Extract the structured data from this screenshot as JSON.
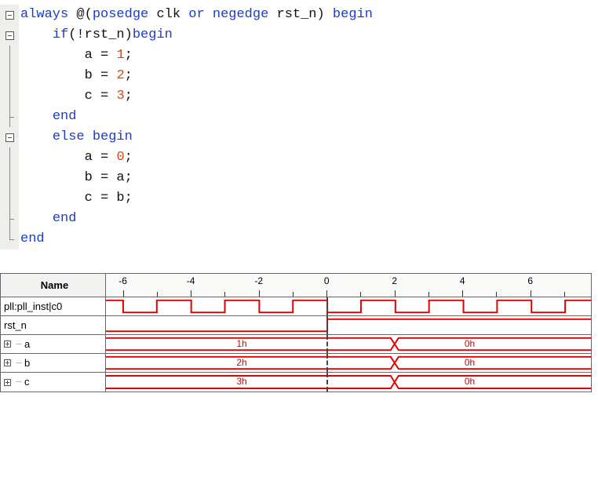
{
  "code": {
    "l1": {
      "kw1": "always",
      "at": " @(",
      "kw2": "posedge",
      "sp1": " clk ",
      "kw3": "or",
      "sp2": " ",
      "kw4": "negedge",
      "sp3": " rst_n) ",
      "kw5": "begin"
    },
    "l2": {
      "ind": "    ",
      "kw1": "if",
      "cond": "(!rst_n)",
      "kw2": "begin"
    },
    "l3": {
      "ind": "        ",
      "txt": "a = ",
      "num": "1",
      "semi": ";"
    },
    "l4": {
      "ind": "        ",
      "txt": "b = ",
      "num": "2",
      "semi": ";"
    },
    "l5": {
      "ind": "        ",
      "txt": "c = ",
      "num": "3",
      "semi": ";"
    },
    "l6": {
      "ind": "    ",
      "kw": "end"
    },
    "l7": {
      "ind": "    ",
      "kw1": "else",
      "sp": " ",
      "kw2": "begin"
    },
    "l8": {
      "ind": "        ",
      "txt": "a = ",
      "num": "0",
      "semi": ";"
    },
    "l9": {
      "ind": "        ",
      "txt": "b = a;"
    },
    "l10": {
      "ind": "        ",
      "txt": "c = b;"
    },
    "l11": {
      "ind": "    ",
      "kw": "end"
    },
    "l12": {
      "kw": "end"
    }
  },
  "wave": {
    "header": "Name",
    "ticks": [
      "-6",
      "-4",
      "-2",
      "0",
      "2",
      "4",
      "6"
    ],
    "signals": {
      "clk": "pll:pll_inst|c0",
      "rst": "rst_n",
      "a": "a",
      "b": "b",
      "c": "c"
    },
    "bus": {
      "a": {
        "before": "1h",
        "after": "0h"
      },
      "b": {
        "before": "2h",
        "after": "0h"
      },
      "c": {
        "before": "3h",
        "after": "0h"
      }
    }
  },
  "chart_data": {
    "type": "table",
    "title": "Waveform",
    "time_axis": {
      "unit": "",
      "ticks": [
        -6,
        -4,
        -2,
        0,
        2,
        4,
        6
      ]
    },
    "cursor_at": 0,
    "signals": [
      {
        "name": "pll:pll_inst|c0",
        "kind": "clock",
        "period": 2,
        "edges_at": [
          -6,
          -5,
          -4,
          -3,
          -2,
          -1,
          0,
          1,
          2,
          3,
          4,
          5,
          6,
          7
        ]
      },
      {
        "name": "rst_n",
        "kind": "bit",
        "segments": [
          {
            "from": -6,
            "to": 0,
            "value": 0
          },
          {
            "from": 0,
            "to": 8,
            "value": 1
          }
        ]
      },
      {
        "name": "a",
        "kind": "bus",
        "segments": [
          {
            "from": -6,
            "to": 2,
            "value": "1h"
          },
          {
            "from": 2,
            "to": 8,
            "value": "0h"
          }
        ]
      },
      {
        "name": "b",
        "kind": "bus",
        "segments": [
          {
            "from": -6,
            "to": 2,
            "value": "2h"
          },
          {
            "from": 2,
            "to": 8,
            "value": "0h"
          }
        ]
      },
      {
        "name": "c",
        "kind": "bus",
        "segments": [
          {
            "from": -6,
            "to": 2,
            "value": "3h"
          },
          {
            "from": 2,
            "to": 8,
            "value": "0h"
          }
        ]
      }
    ]
  }
}
